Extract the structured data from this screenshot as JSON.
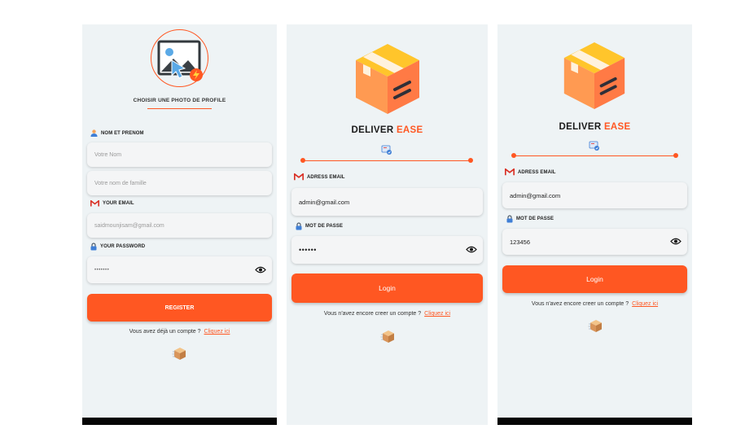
{
  "register": {
    "photo_title": "CHOISIR UNE PHOTO DE PROFILE",
    "name_label": "NOM ET PRENOM",
    "first_name_placeholder": "Votre Nom",
    "last_name_placeholder": "Votre nom de famille",
    "email_label": "YOUR EMAIL",
    "email_value": "saidmounjisam@gmail.com",
    "password_label": "YOUR PASSWORD",
    "password_value": "•••••••",
    "register_button": "REGISTER",
    "footer_text": "Vous avez déjà un compte ?",
    "footer_link": "Cliquez ici"
  },
  "login_hidden": {
    "brand_main": "DELIVER",
    "brand_accent": "EASE",
    "email_label": "ADRESS EMAIL",
    "email_value": "admin@gmail.com",
    "password_label": "MOT DE PASSE",
    "password_value": "••••••",
    "login_button": "Login",
    "footer_text": "Vous n'avez encore creer un compte ?",
    "footer_link": "Cliquez ici"
  },
  "login_visible": {
    "brand_main": "DELIVER",
    "brand_accent": "EASE",
    "email_label": "ADRESS EMAIL",
    "email_value": "admin@gmail.com",
    "password_label": "MOT DE PASSE",
    "password_value": "123456",
    "login_button": "Login",
    "footer_text": "Vous n'avez encore creer un compte ?",
    "footer_link": "Cliquez ici"
  },
  "theme": {
    "accent": "#ff5722",
    "screen_bg": "#eef3f5",
    "box_orange": "#ff9a52",
    "box_yellow": "#ffc52b"
  },
  "icons": [
    "add-photo-icon",
    "user-icon",
    "gmail-icon",
    "lock-icon",
    "eye-icon",
    "logo-box-icon",
    "login-badge-icon",
    "small-box-icon"
  ]
}
